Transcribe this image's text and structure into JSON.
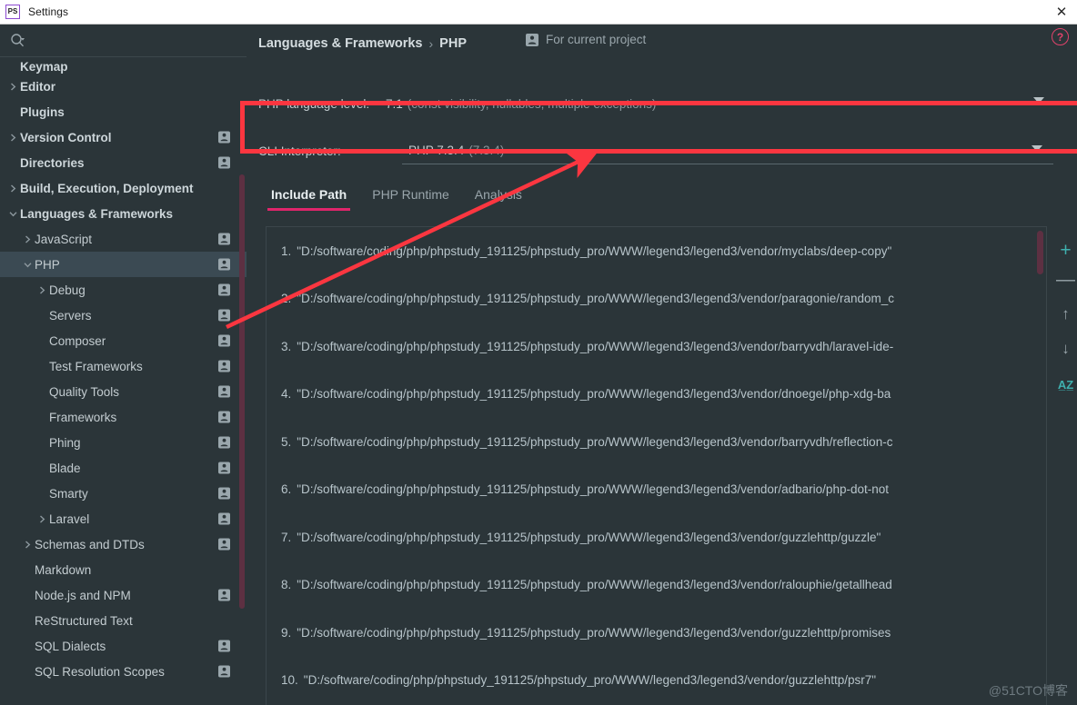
{
  "window": {
    "title": "Settings",
    "app_icon": "phpstorm-icon",
    "close_label": "✕"
  },
  "sidebar": {
    "search": {
      "placeholder": "",
      "value": "",
      "icon": "search-icon"
    },
    "items": [
      {
        "label": "Keymap",
        "level": 0,
        "bold": true,
        "arrow": "none",
        "person": false,
        "selected": false,
        "clipped": true
      },
      {
        "label": "Editor",
        "level": 0,
        "bold": true,
        "arrow": "right",
        "person": false,
        "selected": false
      },
      {
        "label": "Plugins",
        "level": 0,
        "bold": true,
        "arrow": "none",
        "person": false,
        "selected": false
      },
      {
        "label": "Version Control",
        "level": 0,
        "bold": true,
        "arrow": "right",
        "person": true,
        "selected": false
      },
      {
        "label": "Directories",
        "level": 0,
        "bold": true,
        "arrow": "none",
        "person": true,
        "selected": false
      },
      {
        "label": "Build, Execution, Deployment",
        "level": 0,
        "bold": true,
        "arrow": "right",
        "person": false,
        "selected": false
      },
      {
        "label": "Languages & Frameworks",
        "level": 0,
        "bold": true,
        "arrow": "down",
        "person": false,
        "selected": false
      },
      {
        "label": "JavaScript",
        "level": 1,
        "bold": false,
        "arrow": "right",
        "person": true,
        "selected": false
      },
      {
        "label": "PHP",
        "level": 1,
        "bold": false,
        "arrow": "down",
        "person": true,
        "selected": true
      },
      {
        "label": "Debug",
        "level": 2,
        "bold": false,
        "arrow": "right",
        "person": true,
        "selected": false
      },
      {
        "label": "Servers",
        "level": 2,
        "bold": false,
        "arrow": "none",
        "person": true,
        "selected": false
      },
      {
        "label": "Composer",
        "level": 2,
        "bold": false,
        "arrow": "none",
        "person": true,
        "selected": false
      },
      {
        "label": "Test Frameworks",
        "level": 2,
        "bold": false,
        "arrow": "none",
        "person": true,
        "selected": false
      },
      {
        "label": "Quality Tools",
        "level": 2,
        "bold": false,
        "arrow": "none",
        "person": true,
        "selected": false
      },
      {
        "label": "Frameworks",
        "level": 2,
        "bold": false,
        "arrow": "none",
        "person": true,
        "selected": false
      },
      {
        "label": "Phing",
        "level": 2,
        "bold": false,
        "arrow": "none",
        "person": true,
        "selected": false
      },
      {
        "label": "Blade",
        "level": 2,
        "bold": false,
        "arrow": "none",
        "person": true,
        "selected": false
      },
      {
        "label": "Smarty",
        "level": 2,
        "bold": false,
        "arrow": "none",
        "person": true,
        "selected": false
      },
      {
        "label": "Laravel",
        "level": 2,
        "bold": false,
        "arrow": "right",
        "person": true,
        "selected": false
      },
      {
        "label": "Schemas and DTDs",
        "level": 1,
        "bold": false,
        "arrow": "right",
        "person": true,
        "selected": false
      },
      {
        "label": "Markdown",
        "level": 1,
        "bold": false,
        "arrow": "none",
        "person": false,
        "selected": false
      },
      {
        "label": "Node.js and NPM",
        "level": 1,
        "bold": false,
        "arrow": "none",
        "person": true,
        "selected": false
      },
      {
        "label": "ReStructured Text",
        "level": 1,
        "bold": false,
        "arrow": "none",
        "person": false,
        "selected": false
      },
      {
        "label": "SQL Dialects",
        "level": 1,
        "bold": false,
        "arrow": "none",
        "person": true,
        "selected": false
      },
      {
        "label": "SQL Resolution Scopes",
        "level": 1,
        "bold": false,
        "arrow": "none",
        "person": true,
        "selected": false
      }
    ]
  },
  "header": {
    "breadcrumb_parent": "Languages & Frameworks",
    "breadcrumb_sep": "›",
    "breadcrumb_current": "PHP",
    "scope_icon": "person-icon",
    "scope_label": "For current project"
  },
  "language_level": {
    "label": "PHP language level:",
    "value": "7.1",
    "value_description": "(const visibility, nullables, multiple exceptions)",
    "help_glyph": "?"
  },
  "cli_interpreter": {
    "label": "CLI Interpreter:",
    "value": "PHP 7.3.4",
    "value_suffix": "(7.3.4)"
  },
  "tabs": [
    {
      "label": "Include Path",
      "active": true
    },
    {
      "label": "PHP Runtime",
      "active": false
    },
    {
      "label": "Analysis",
      "active": false
    }
  ],
  "include_path": {
    "rows": [
      {
        "num": "1.",
        "path": "\"D:/software/coding/php/phpstudy_191125/phpstudy_pro/WWW/legend3/legend3/vendor/myclabs/deep-copy\""
      },
      {
        "num": "2.",
        "path": "\"D:/software/coding/php/phpstudy_191125/phpstudy_pro/WWW/legend3/legend3/vendor/paragonie/random_c"
      },
      {
        "num": "3.",
        "path": "\"D:/software/coding/php/phpstudy_191125/phpstudy_pro/WWW/legend3/legend3/vendor/barryvdh/laravel-ide-"
      },
      {
        "num": "4.",
        "path": "\"D:/software/coding/php/phpstudy_191125/phpstudy_pro/WWW/legend3/legend3/vendor/dnoegel/php-xdg-ba"
      },
      {
        "num": "5.",
        "path": "\"D:/software/coding/php/phpstudy_191125/phpstudy_pro/WWW/legend3/legend3/vendor/barryvdh/reflection-c"
      },
      {
        "num": "6.",
        "path": "\"D:/software/coding/php/phpstudy_191125/phpstudy_pro/WWW/legend3/legend3/vendor/adbario/php-dot-not"
      },
      {
        "num": "7.",
        "path": "\"D:/software/coding/php/phpstudy_191125/phpstudy_pro/WWW/legend3/legend3/vendor/guzzlehttp/guzzle\""
      },
      {
        "num": "8.",
        "path": "\"D:/software/coding/php/phpstudy_191125/phpstudy_pro/WWW/legend3/legend3/vendor/ralouphie/getallhead"
      },
      {
        "num": "9.",
        "path": "\"D:/software/coding/php/phpstudy_191125/phpstudy_pro/WWW/legend3/legend3/vendor/guzzlehttp/promises"
      },
      {
        "num": "10.",
        "path": "\"D:/software/coding/php/phpstudy_191125/phpstudy_pro/WWW/legend3/legend3/vendor/guzzlehttp/psr7\""
      }
    ]
  },
  "list_toolbar": [
    {
      "name": "add-button",
      "glyph": "+",
      "color": "#3fb0ae"
    },
    {
      "name": "remove-button",
      "glyph": "—",
      "color": "#9aa6ac"
    },
    {
      "name": "move-up-button",
      "glyph": "↑",
      "color": "#9aa6ac"
    },
    {
      "name": "move-down-button",
      "glyph": "↓",
      "color": "#9aa6ac"
    },
    {
      "name": "sort-button",
      "glyph": "A̲Z̲",
      "color": "#3fb0ae"
    }
  ],
  "annotation": {
    "highlight_color": "#fb3640",
    "arrow_color": "#fb3640"
  },
  "watermark": "@51CTO博客",
  "colors": {
    "background": "#2b3539",
    "sidebar_selected": "#3b4a53",
    "accent_tab": "#e0256b",
    "accent_teal": "#3fb0ae",
    "scrollbar": "#5d3042",
    "help_pink": "#e0436b"
  }
}
